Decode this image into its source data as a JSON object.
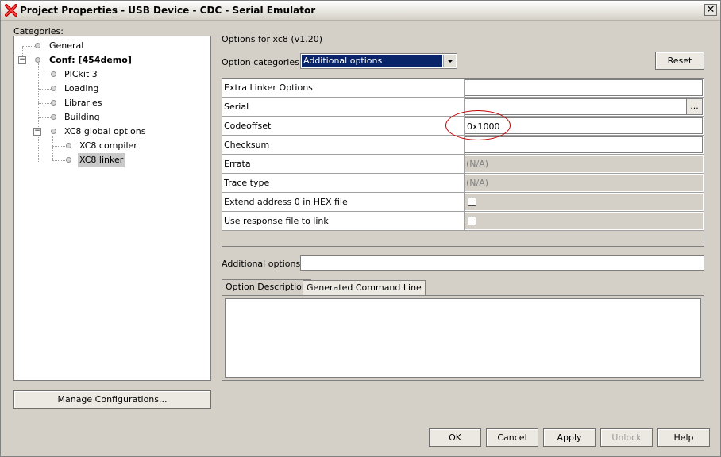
{
  "window": {
    "title": "Project Properties - USB Device - CDC - Serial Emulator",
    "close_glyph": "✕",
    "icon": "app-x-icon"
  },
  "categories": {
    "label": "Categories:",
    "items": [
      {
        "label": "General"
      },
      {
        "label": "Conf: [454demo]"
      },
      {
        "label": "PICkit 3"
      },
      {
        "label": "Loading"
      },
      {
        "label": "Libraries"
      },
      {
        "label": "Building"
      },
      {
        "label": "XC8 global options"
      },
      {
        "label": "XC8 compiler"
      },
      {
        "label": "XC8 linker",
        "selected": true
      }
    ]
  },
  "manage_button": "Manage Configurations...",
  "options_for": "Options for xc8 (v1.20)",
  "option_categories": {
    "label": "Option categories:",
    "value": "Additional options"
  },
  "reset_button": "Reset",
  "properties": [
    {
      "name": "Extra Linker Options",
      "value": ""
    },
    {
      "name": "Serial",
      "value": "",
      "button": "..."
    },
    {
      "name": "Codeoffset",
      "value": "0x1000"
    },
    {
      "name": "Checksum",
      "value": ""
    },
    {
      "name": "Errata",
      "value": "(N/A)"
    },
    {
      "name": "Trace type",
      "value": "(N/A)"
    },
    {
      "name": "Extend address 0 in HEX file",
      "checked": false
    },
    {
      "name": "Use response file to link",
      "checked": false
    }
  ],
  "additional_options": {
    "label": "Additional options:",
    "value": ""
  },
  "tabs": [
    {
      "label": "Option Description",
      "active": true
    },
    {
      "label": "Generated Command Line",
      "active": false
    }
  ],
  "footer_buttons": {
    "ok": "OK",
    "cancel": "Cancel",
    "apply": "Apply",
    "unlock": "Unlock",
    "help": "Help"
  },
  "annotation_color": "#c00000",
  "selection_color": "#0a246a"
}
